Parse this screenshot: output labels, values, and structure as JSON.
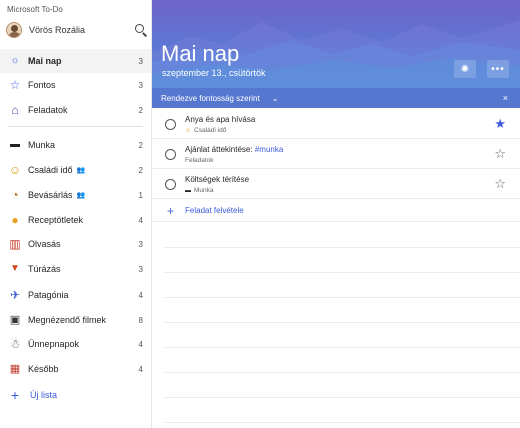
{
  "app": {
    "title": "Microsoft To-Do"
  },
  "user": {
    "name": "Vörös Rozália"
  },
  "sidebar": {
    "items": [
      {
        "label": "Mai nap",
        "count": "3",
        "icon": "sun-icon",
        "glyph": "☼",
        "color": "#3b5bdb",
        "active": true
      },
      {
        "label": "Fontos",
        "count": "3",
        "icon": "star-icon",
        "glyph": "☆",
        "color": "#3b5bdb"
      },
      {
        "label": "Feladatok",
        "count": "2",
        "icon": "home-icon",
        "glyph": "⌂",
        "color": "#6a3fb5"
      },
      {
        "label": "Munka",
        "count": "2",
        "icon": "laptop-icon",
        "glyph": "▬",
        "color": "#222"
      },
      {
        "label": "Családi idő",
        "count": "2",
        "icon": "smiley-icon",
        "glyph": "☺",
        "color": "#d4a017",
        "shared": true
      },
      {
        "label": "Bevásárlás",
        "count": "1",
        "icon": "cart-icon",
        "glyph": "◔",
        "color": "#b5651d",
        "shared": true
      },
      {
        "label": "Receptötletek",
        "count": "4",
        "icon": "food-icon",
        "glyph": "●",
        "color": "#e6a21b"
      },
      {
        "label": "Olvasás",
        "count": "3",
        "icon": "book-icon",
        "glyph": "▥",
        "color": "#c0392b"
      },
      {
        "label": "Túrázás",
        "count": "3",
        "icon": "fox-icon",
        "glyph": "▼",
        "color": "#d2491c"
      },
      {
        "label": "Patagónia",
        "count": "4",
        "icon": "plane-icon",
        "glyph": "✈",
        "color": "#3b5bdb"
      },
      {
        "label": "Megnézendő filmek",
        "count": "8",
        "icon": "film-icon",
        "glyph": "▣",
        "color": "#333"
      },
      {
        "label": "Ünnepnapok",
        "count": "4",
        "icon": "snowman-icon",
        "glyph": "☃",
        "color": "#555"
      },
      {
        "label": "Később",
        "count": "4",
        "icon": "calendar-icon",
        "glyph": "▦",
        "color": "#c0392b"
      }
    ],
    "new_list_label": "Új lista"
  },
  "main": {
    "title": "Mai nap",
    "date": "szeptember 13., csütörtök",
    "more_label": "•••",
    "sort": {
      "label": "Rendezve fontosság szerint",
      "close": "×"
    },
    "tasks": [
      {
        "title": "Anya és apa hívása",
        "title_tag": "",
        "list": "Családi idő",
        "list_icon": "☺",
        "important": true
      },
      {
        "title": "Ajánlat áttekintése: ",
        "title_tag": "#munka",
        "list": "Feladatok",
        "list_icon": "",
        "important": false
      },
      {
        "title": "Költségek térítése",
        "title_tag": "",
        "list": "Munka",
        "list_icon": "▬",
        "important": false
      }
    ],
    "add_task_label": "Feladat felvétele"
  },
  "colors": {
    "accent": "#3b5bdb",
    "hero_top": "#6f64c8",
    "hero_bottom": "#4d86d8"
  }
}
